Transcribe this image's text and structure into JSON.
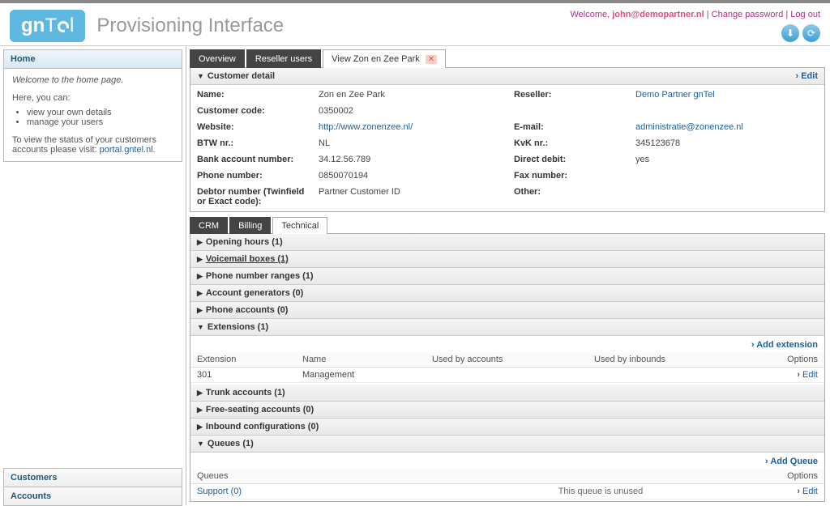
{
  "header": {
    "logo": "gnTel",
    "title": "Provisioning Interface",
    "welcome": "Welcome, ",
    "user": "john@demopartner.nl",
    "change_pw": "Change password",
    "logout": "Log out"
  },
  "sidebar": {
    "home": "Home",
    "welcome_line": "Welcome to the home page.",
    "here_you_can": "Here, you can:",
    "bullets": [
      "view your own details",
      "manage your users"
    ],
    "status_pre": "To view the status of your customers accounts please visit: ",
    "status_link": "portal.gntel.nl",
    "customers": "Customers",
    "accounts": "Accounts"
  },
  "tabs": {
    "overview": "Overview",
    "reseller": "Reseller users",
    "view": "View Zon en Zee Park"
  },
  "customer": {
    "section": "Customer detail",
    "edit": "Edit",
    "fields": {
      "name_l": "Name:",
      "name_v": "Zon en Zee Park",
      "reseller_l": "Reseller:",
      "reseller_v": "Demo Partner gnTel",
      "code_l": "Customer code:",
      "code_v": "0350002",
      "website_l": "Website:",
      "website_v": "http://www.zonenzee.nl/",
      "email_l": "E-mail:",
      "email_v": "administratie@zonenzee.nl",
      "btw_l": "BTW nr.:",
      "btw_v": "NL",
      "kvk_l": "KvK nr.:",
      "kvk_v": "345123678",
      "bank_l": "Bank account number:",
      "bank_v": "34.12.56.789",
      "dd_l": "Direct debit:",
      "dd_v": "yes",
      "phone_l": "Phone number:",
      "phone_v": "0850070194",
      "fax_l": "Fax number:",
      "fax_v": "",
      "debtor_l": "Debtor number (Twinfield or Exact code):",
      "debtor_v": "Partner Customer ID",
      "other_l": "Other:",
      "other_v": ""
    }
  },
  "subtabs": {
    "crm": "CRM",
    "billing": "Billing",
    "tech": "Technical"
  },
  "acc": {
    "opening": "Opening hours (1)",
    "vm": "Voicemail boxes (1)",
    "pnr": "Phone number ranges (1)",
    "ag": "Account generators (0)",
    "pa": "Phone accounts (0)",
    "ext": "Extensions (1)",
    "trunk": "Trunk accounts (1)",
    "fs": "Free-seating accounts (0)",
    "ic": "Inbound configurations (0)",
    "q": "Queues (1)"
  },
  "ext_table": {
    "add": "Add extension",
    "cols": {
      "ext": "Extension",
      "name": "Name",
      "uba": "Used by accounts",
      "ubi": "Used by inbounds",
      "opt": "Options"
    },
    "row": {
      "ext": "301",
      "name": "Management",
      "edit": "Edit"
    }
  },
  "q_table": {
    "add": "Add Queue",
    "cols": {
      "q": "Queues",
      "opt": "Options"
    },
    "row": {
      "name": "Support (0)",
      "note": "This queue is unused",
      "edit": "Edit"
    }
  }
}
